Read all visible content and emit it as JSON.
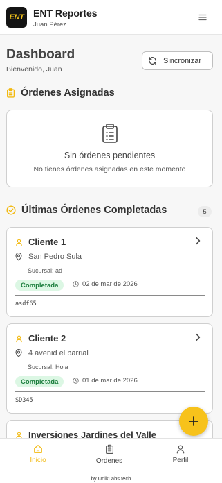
{
  "header": {
    "logo_text": "ENT",
    "app_title": "ENT Reportes",
    "user_name": "Juan Pérez"
  },
  "dashboard": {
    "title": "Dashboard",
    "subtitle": "Bienvenido, Juan",
    "sync_label": "Sincronizar"
  },
  "assigned": {
    "heading": "Órdenes Asignadas",
    "empty_title": "Sin órdenes pendientes",
    "empty_desc": "No tienes órdenes asignadas en este momento"
  },
  "completed": {
    "heading": "Últimas Órdenes Completadas",
    "count": "5",
    "orders": [
      {
        "client": "Cliente 1",
        "location": "San Pedro Sula",
        "branch": "Sucursal: ad",
        "status": "Completada",
        "date": "02 de mar de 2026",
        "code": "asdf65"
      },
      {
        "client": "Cliente 2",
        "location": "4 avenid el barrial",
        "branch": "Sucursal: Hola",
        "status": "Completada",
        "date": "01 de mar de 2026",
        "code": "SD345"
      },
      {
        "client": "Inversiones Jardines del Valle"
      }
    ]
  },
  "nav": {
    "items": [
      {
        "label": "Inicio"
      },
      {
        "label": "Ordenes"
      },
      {
        "label": "Perfil"
      }
    ]
  },
  "footer": {
    "credit": "by UnikLabs.tech"
  },
  "colors": {
    "accent": "#f5c51b",
    "status_bg": "#dcf7e4",
    "status_text": "#1e7f3f"
  },
  "icons": [
    "menu-icon",
    "refresh-icon",
    "clipboard-icon",
    "check-circle-icon",
    "user-icon",
    "map-pin-icon",
    "clock-icon",
    "chevron-right-icon",
    "plus-icon",
    "home-icon",
    "profile-icon"
  ]
}
